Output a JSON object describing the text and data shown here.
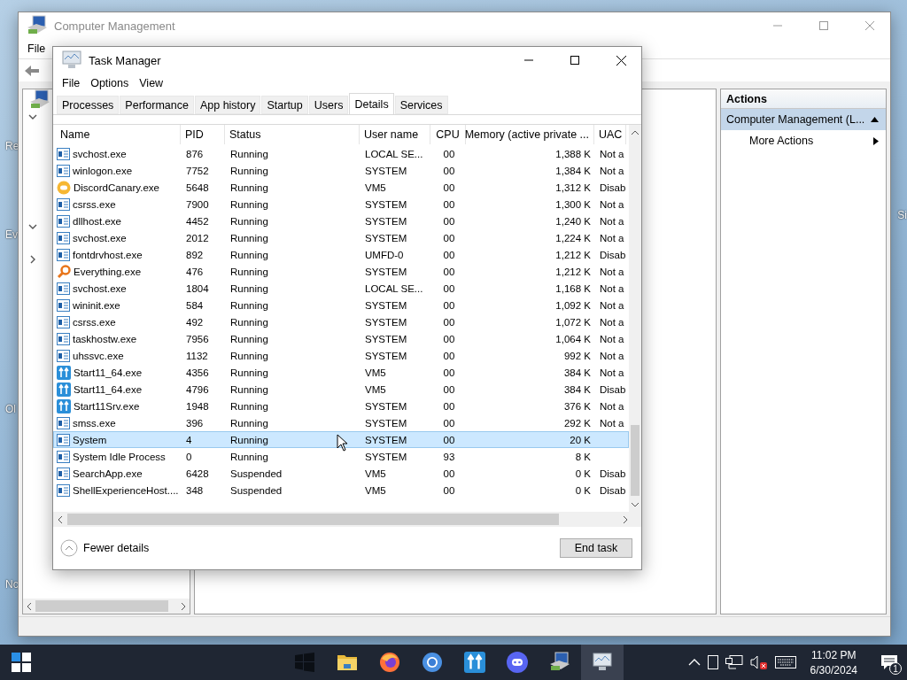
{
  "desktop_labels": [
    {
      "text": "Re",
      "kind": "left"
    },
    {
      "text": "Ev",
      "kind": "left"
    },
    {
      "text": "Ol",
      "kind": "left"
    },
    {
      "text": "Nc",
      "kind": "left"
    },
    {
      "text": "Si",
      "kind": "right"
    }
  ],
  "computer_management": {
    "title": "Computer Management",
    "menu": [
      "File"
    ],
    "tree": [
      {
        "kind": "root"
      },
      {
        "kind": "node",
        "expanded": true
      },
      {
        "kind": "node",
        "expanded": true
      },
      {
        "kind": "node",
        "expanded": false
      }
    ],
    "actions": {
      "header": "Actions",
      "items": [
        {
          "label": "Computer Management (L...",
          "kind": "group",
          "expanded": true
        },
        {
          "label": "More Actions",
          "kind": "submenu"
        }
      ]
    }
  },
  "task_manager": {
    "title": "Task Manager",
    "menu": [
      "File",
      "Options",
      "View"
    ],
    "tabs": [
      {
        "label": "Processes",
        "selected": false
      },
      {
        "label": "Performance",
        "selected": false
      },
      {
        "label": "App history",
        "selected": false
      },
      {
        "label": "Startup",
        "selected": false
      },
      {
        "label": "Users",
        "selected": false
      },
      {
        "label": "Details",
        "selected": true
      },
      {
        "label": "Services",
        "selected": false
      }
    ],
    "columns": [
      "Name",
      "PID",
      "Status",
      "User name",
      "CPU",
      "Memory (active private ...",
      "UAC"
    ],
    "rows": [
      {
        "kind": "window",
        "name": "svchost.exe",
        "pid": "876",
        "status": "Running",
        "user": "LOCAL SE...",
        "cpu": "00",
        "memory": "1,388 K",
        "uac": "Not a",
        "selected": false
      },
      {
        "kind": "window",
        "name": "winlogon.exe",
        "pid": "7752",
        "status": "Running",
        "user": "SYSTEM",
        "cpu": "00",
        "memory": "1,384 K",
        "uac": "Not a",
        "selected": false
      },
      {
        "kind": "discord",
        "name": "DiscordCanary.exe",
        "pid": "5648",
        "status": "Running",
        "user": "VM5",
        "cpu": "00",
        "memory": "1,312 K",
        "uac": "Disab",
        "selected": false
      },
      {
        "kind": "window",
        "name": "csrss.exe",
        "pid": "7900",
        "status": "Running",
        "user": "SYSTEM",
        "cpu": "00",
        "memory": "1,300 K",
        "uac": "Not a",
        "selected": false
      },
      {
        "kind": "window",
        "name": "dllhost.exe",
        "pid": "4452",
        "status": "Running",
        "user": "SYSTEM",
        "cpu": "00",
        "memory": "1,240 K",
        "uac": "Not a",
        "selected": false
      },
      {
        "kind": "window",
        "name": "svchost.exe",
        "pid": "2012",
        "status": "Running",
        "user": "SYSTEM",
        "cpu": "00",
        "memory": "1,224 K",
        "uac": "Not a",
        "selected": false
      },
      {
        "kind": "window",
        "name": "fontdrvhost.exe",
        "pid": "892",
        "status": "Running",
        "user": "UMFD-0",
        "cpu": "00",
        "memory": "1,212 K",
        "uac": "Disab",
        "selected": false
      },
      {
        "kind": "search",
        "name": "Everything.exe",
        "pid": "476",
        "status": "Running",
        "user": "SYSTEM",
        "cpu": "00",
        "memory": "1,212 K",
        "uac": "Not a",
        "selected": false
      },
      {
        "kind": "window",
        "name": "svchost.exe",
        "pid": "1804",
        "status": "Running",
        "user": "LOCAL SE...",
        "cpu": "00",
        "memory": "1,168 K",
        "uac": "Not a",
        "selected": false
      },
      {
        "kind": "window",
        "name": "wininit.exe",
        "pid": "584",
        "status": "Running",
        "user": "SYSTEM",
        "cpu": "00",
        "memory": "1,092 K",
        "uac": "Not a",
        "selected": false
      },
      {
        "kind": "window",
        "name": "csrss.exe",
        "pid": "492",
        "status": "Running",
        "user": "SYSTEM",
        "cpu": "00",
        "memory": "1,072 K",
        "uac": "Not a",
        "selected": false
      },
      {
        "kind": "window",
        "name": "taskhostw.exe",
        "pid": "7956",
        "status": "Running",
        "user": "SYSTEM",
        "cpu": "00",
        "memory": "1,064 K",
        "uac": "Not a",
        "selected": false
      },
      {
        "kind": "window",
        "name": "uhssvc.exe",
        "pid": "1132",
        "status": "Running",
        "user": "SYSTEM",
        "cpu": "00",
        "memory": "992 K",
        "uac": "Not a",
        "selected": false
      },
      {
        "kind": "start11",
        "name": "Start11_64.exe",
        "pid": "4356",
        "status": "Running",
        "user": "VM5",
        "cpu": "00",
        "memory": "384 K",
        "uac": "Not a",
        "selected": false
      },
      {
        "kind": "start11",
        "name": "Start11_64.exe",
        "pid": "4796",
        "status": "Running",
        "user": "VM5",
        "cpu": "00",
        "memory": "384 K",
        "uac": "Disab",
        "selected": false
      },
      {
        "kind": "start11",
        "name": "Start11Srv.exe",
        "pid": "1948",
        "status": "Running",
        "user": "SYSTEM",
        "cpu": "00",
        "memory": "376 K",
        "uac": "Not a",
        "selected": false
      },
      {
        "kind": "window",
        "name": "smss.exe",
        "pid": "396",
        "status": "Running",
        "user": "SYSTEM",
        "cpu": "00",
        "memory": "292 K",
        "uac": "Not a",
        "selected": false
      },
      {
        "kind": "window",
        "name": "System",
        "pid": "4",
        "status": "Running",
        "user": "SYSTEM",
        "cpu": "00",
        "memory": "20 K",
        "selected": true
      },
      {
        "kind": "window",
        "name": "System Idle Process",
        "pid": "0",
        "status": "Running",
        "user": "SYSTEM",
        "cpu": "93",
        "memory": "8 K",
        "selected": false
      },
      {
        "kind": "window",
        "name": "SearchApp.exe",
        "pid": "6428",
        "status": "Suspended",
        "user": "VM5",
        "cpu": "00",
        "memory": "0 K",
        "uac": "Disab",
        "selected": false
      },
      {
        "kind": "window",
        "name": "ShellExperienceHost....",
        "pid": "348",
        "status": "Suspended",
        "user": "VM5",
        "cpu": "00",
        "memory": "0 K",
        "uac": "Disab",
        "selected": false
      }
    ],
    "fewer_details": "Fewer details",
    "end_task": "End task"
  },
  "taskbar": {
    "apps": [
      {
        "kind": "windows",
        "selected": false
      },
      {
        "kind": "folder",
        "selected": false
      },
      {
        "kind": "firefox",
        "selected": false
      },
      {
        "kind": "chrome",
        "selected": false
      },
      {
        "kind": "start11",
        "selected": false
      },
      {
        "kind": "discord",
        "selected": false
      },
      {
        "kind": "management",
        "selected": false
      },
      {
        "kind": "taskmanager",
        "selected": true
      }
    ],
    "time": "11:02 PM",
    "date": "6/30/2024",
    "notifications": "1"
  }
}
